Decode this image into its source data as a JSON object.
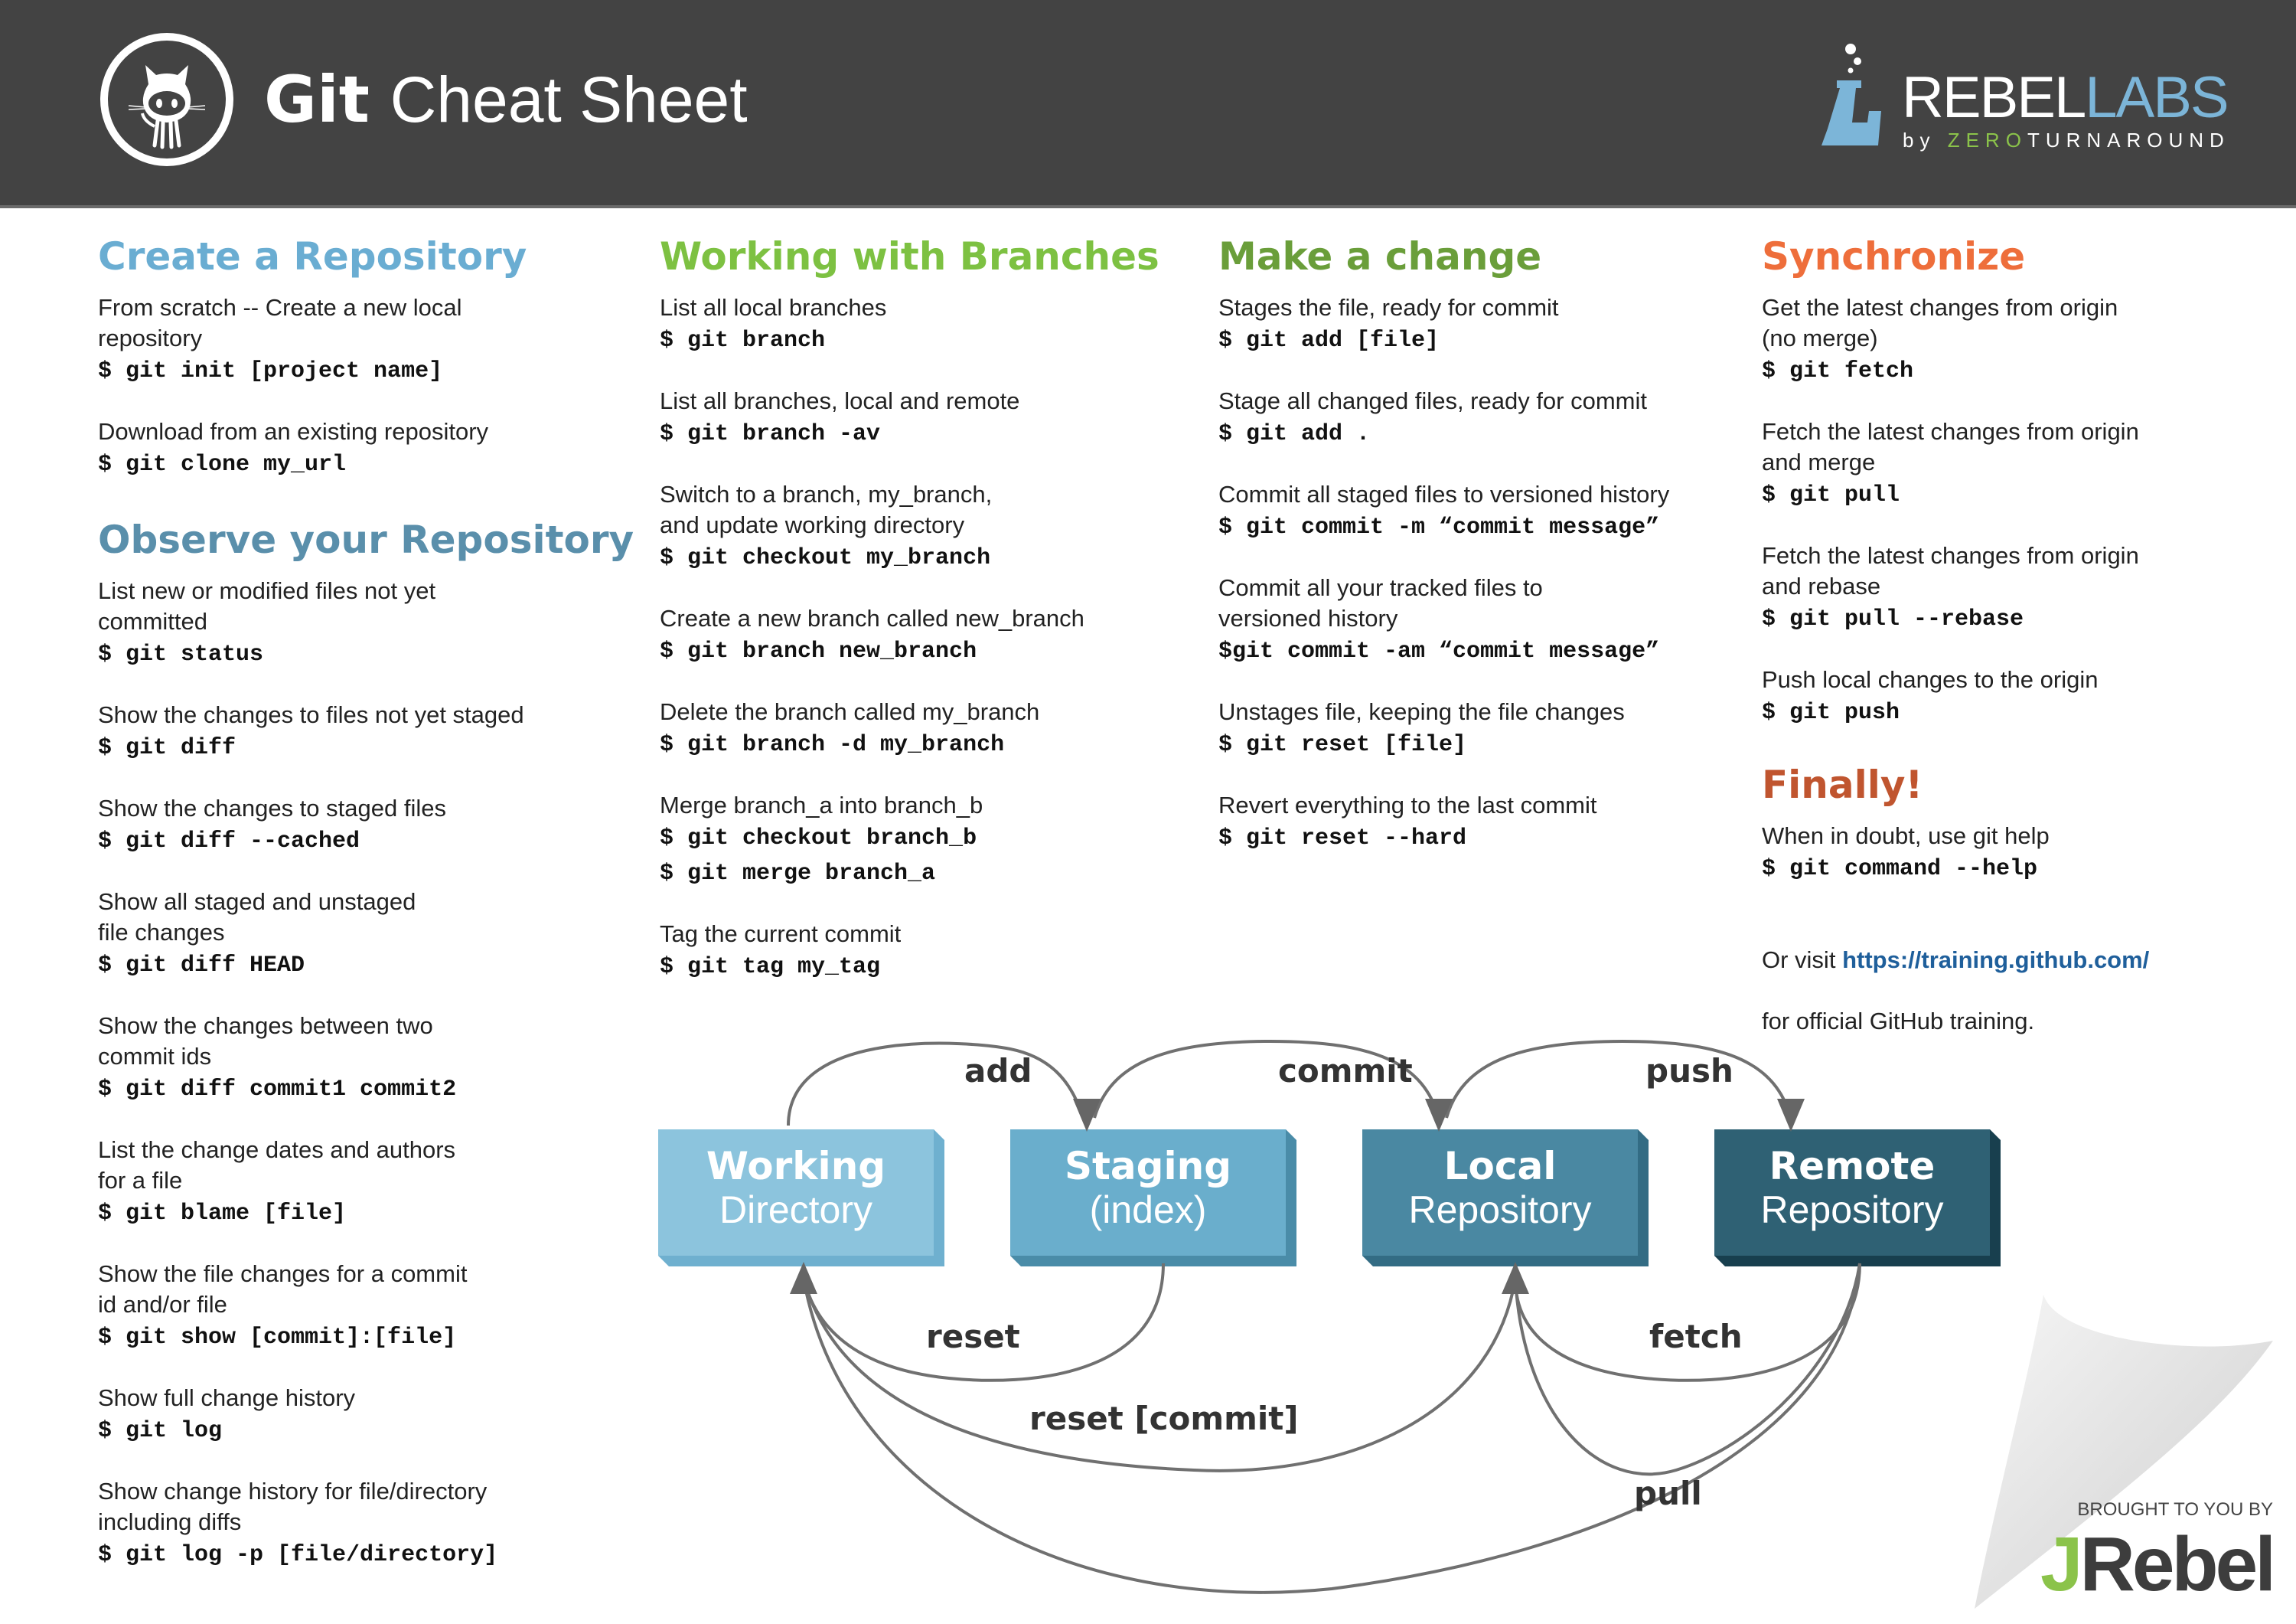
{
  "header": {
    "title_bold": "Git",
    "title_light": "Cheat Sheet",
    "brand": {
      "name_white": "REBEL",
      "name_blue": "LABS",
      "by": "by",
      "by_green": "ZERO",
      "by_white": "TURNAROUND"
    }
  },
  "colors": {
    "header_bg": "#434343",
    "create_title": "#6aadd2",
    "observe_title": "#5a8fab",
    "branches_title": "#7dc142",
    "change_title": "#6a9e3a",
    "sync_title": "#ee6e3b",
    "finally_title": "#c0552f",
    "link": "#1f5f9b"
  },
  "sections": {
    "create": {
      "title": "Create a Repository",
      "entries": [
        {
          "desc": "From scratch -- Create a new local\nrepository",
          "cmds": [
            "$ git init [project name]"
          ]
        },
        {
          "desc": "Download from an existing repository",
          "cmds": [
            "$ git clone my_url"
          ]
        }
      ]
    },
    "observe": {
      "title": "Observe your Repository",
      "entries": [
        {
          "desc": "List new or modified files not yet\ncommitted",
          "cmds": [
            "$ git status"
          ]
        },
        {
          "desc": "Show the changes to files not yet staged",
          "cmds": [
            "$ git diff"
          ]
        },
        {
          "desc": "Show the changes to staged files",
          "cmds": [
            "$ git diff --cached"
          ]
        },
        {
          "desc": "Show all staged and unstaged\nfile changes",
          "cmds": [
            "$ git diff HEAD"
          ]
        },
        {
          "desc": "Show the changes between two\ncommit ids",
          "cmds": [
            "$ git diff commit1 commit2"
          ]
        },
        {
          "desc": "List the change dates and authors\nfor a file",
          "cmds": [
            "$ git blame [file]"
          ]
        },
        {
          "desc": "Show the file changes for a commit\nid and/or file",
          "cmds": [
            "$ git show [commit]:[file]"
          ]
        },
        {
          "desc": "Show full change history",
          "cmds": [
            "$ git log"
          ]
        },
        {
          "desc": "Show change history for file/directory\nincluding diffs",
          "cmds": [
            "$ git log -p [file/directory]"
          ]
        }
      ]
    },
    "branches": {
      "title": "Working with Branches",
      "entries": [
        {
          "desc": "List all local branches",
          "cmds": [
            "$ git branch"
          ]
        },
        {
          "desc": "List all branches, local and remote",
          "cmds": [
            "$ git branch -av"
          ]
        },
        {
          "desc": "Switch to a branch, my_branch,\nand update working directory",
          "cmds": [
            "$ git checkout my_branch"
          ]
        },
        {
          "desc": "Create a new branch called new_branch",
          "cmds": [
            "$ git branch new_branch"
          ]
        },
        {
          "desc": "Delete the branch called my_branch",
          "cmds": [
            "$ git branch -d my_branch"
          ]
        },
        {
          "desc": "Merge branch_a into branch_b",
          "cmds": [
            "$ git checkout branch_b",
            "$ git merge branch_a"
          ]
        },
        {
          "desc": "Tag the current commit",
          "cmds": [
            "$ git tag my_tag"
          ]
        }
      ]
    },
    "change": {
      "title": "Make a change",
      "entries": [
        {
          "desc": "Stages the file, ready for commit",
          "cmds": [
            "$ git add [file]"
          ]
        },
        {
          "desc": "Stage all changed files, ready for commit",
          "cmds": [
            "$ git add ."
          ]
        },
        {
          "desc": "Commit all staged files to versioned history",
          "cmds": [
            "$ git commit -m “commit message”"
          ]
        },
        {
          "desc": "Commit all your tracked files to\nversioned history",
          "cmds": [
            "$git commit -am “commit message”"
          ]
        },
        {
          "desc": "Unstages file, keeping the file changes",
          "cmds": [
            "$ git reset [file]"
          ]
        },
        {
          "desc": "Revert everything to the last commit",
          "cmds": [
            "$ git reset --hard"
          ]
        }
      ]
    },
    "sync": {
      "title": "Synchronize",
      "entries": [
        {
          "desc": "Get the latest changes from origin\n(no merge)",
          "cmds": [
            "$ git fetch"
          ]
        },
        {
          "desc": "Fetch the latest changes from origin\nand merge",
          "cmds": [
            "$ git pull"
          ]
        },
        {
          "desc": "Fetch the latest changes from origin\nand rebase",
          "cmds": [
            "$ git pull --rebase"
          ]
        },
        {
          "desc": "Push local changes to the origin",
          "cmds": [
            "$ git push"
          ]
        }
      ]
    },
    "finally": {
      "title": "Finally!",
      "desc": "When in doubt, use git help",
      "cmd": "$ git command --help",
      "visit_prefix": "Or visit ",
      "visit_link": "https://training.github.com/",
      "visit_suffix": "for official GitHub training."
    }
  },
  "diagram": {
    "boxes": [
      {
        "bold": "Working",
        "light": "Directory",
        "color": "#8cc4dd",
        "side": "#6fb0cf"
      },
      {
        "bold": "Staging",
        "light": "(index)",
        "color": "#6aaecc",
        "side": "#4a8ca8"
      },
      {
        "bold": "Local",
        "light": "Repository",
        "color": "#4a88a2",
        "side": "#336c84"
      },
      {
        "bold": "Remote",
        "light": "Repository",
        "color": "#2f6174",
        "side": "#183f4e"
      }
    ],
    "arrows": {
      "add": "add",
      "commit": "commit",
      "push": "push",
      "reset": "reset",
      "fetch": "fetch",
      "reset_commit": "reset [commit]",
      "pull": "pull"
    }
  },
  "footer": {
    "brought": "BROUGHT TO YOU BY",
    "jrebel_j": "J",
    "jrebel_rest": "Rebel"
  }
}
